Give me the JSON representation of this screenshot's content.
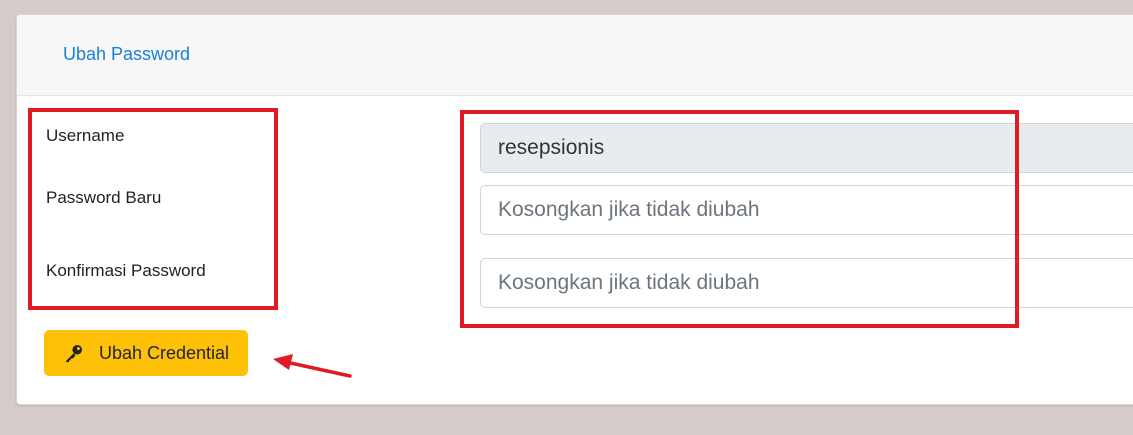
{
  "header": {
    "tab_label": "Ubah Password"
  },
  "form": {
    "username_label": "Username",
    "username_value": "resepsionis",
    "new_password_label": "Password Baru",
    "new_password_placeholder": "Kosongkan jika tidak diubah",
    "confirm_password_label": "Konfirmasi Password",
    "confirm_password_placeholder": "Kosongkan jika tidak diubah",
    "submit_label": "Ubah Credential"
  },
  "colors": {
    "accent_link": "#1a7fd6",
    "button_warning": "#ffc107",
    "annotation_red": "#e01b24"
  }
}
